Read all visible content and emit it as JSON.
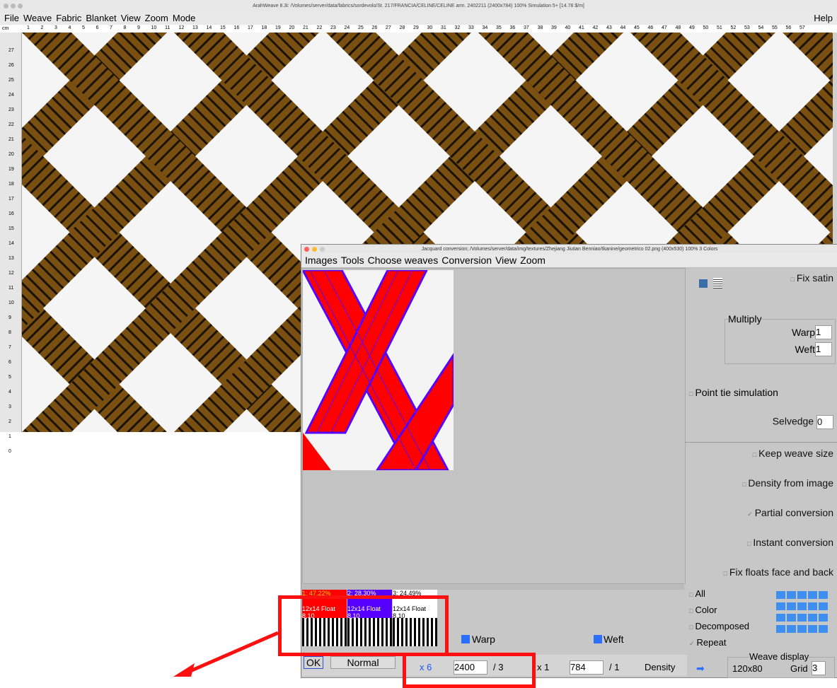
{
  "main_window": {
    "title": "ArahWeave 8.3i: /Volumes/server/data/fabrics/sordevolo/St. 217/FRANCIA/CELINE/CELINE arm. 2402211 (2400x784) 100% Simulation 5+ [14.78 $/m]",
    "menu": [
      "File",
      "Weave",
      "Fabric",
      "Blanket",
      "View",
      "Zoom",
      "Mode"
    ],
    "help": "Help",
    "ruler_unit": "cm",
    "ruler_top": [
      "1",
      "2",
      "3",
      "4",
      "5",
      "6",
      "7",
      "8",
      "9",
      "10",
      "11",
      "12",
      "13",
      "14",
      "15",
      "16",
      "17",
      "18",
      "19",
      "20",
      "21",
      "22",
      "23",
      "24",
      "25",
      "26",
      "27",
      "28",
      "29",
      "30",
      "31",
      "32",
      "33",
      "34",
      "35",
      "36",
      "37",
      "38",
      "39",
      "40",
      "41",
      "42",
      "43",
      "44",
      "45",
      "46",
      "47",
      "48",
      "49",
      "50",
      "51",
      "52",
      "53",
      "54",
      "55",
      "56",
      "57"
    ],
    "ruler_left": [
      "27",
      "26",
      "25",
      "24",
      "23",
      "22",
      "21",
      "20",
      "19",
      "18",
      "17",
      "16",
      "15",
      "14",
      "13",
      "12",
      "11",
      "10",
      "9",
      "8",
      "7",
      "6",
      "5",
      "4",
      "3",
      "2",
      "1",
      "0"
    ],
    "colors": {
      "brown": "#7a4f12",
      "dark": "#1a1200",
      "white": "#f5f5f5"
    }
  },
  "jacquard": {
    "title": "Jacquard conversion; /Volumes/server/data/img/textures/Zhejiang Jiutian Benniao/tkanine/geometrico 02.png (400x530) 100% 3 Colors",
    "menu": [
      "Images",
      "Tools",
      "Choose weaves",
      "Conversion",
      "View",
      "Zoom"
    ],
    "options": {
      "fix_satin": "Fix satin",
      "multiply": "Multiply",
      "warp": "Warp",
      "warp_value": "1",
      "weft": "Weft",
      "weft_value": "1",
      "point_tie": "Point tie simulation",
      "selvedge": "Selvedge",
      "selvedge_value": "0",
      "keep_weave_size": "Keep weave size",
      "density_from_image": "Density from image",
      "partial_conversion": "Partial conversion",
      "instant_conversion": "Instant conversion",
      "fix_floats": "Fix floats face and back"
    },
    "display_options": [
      "All",
      "Color",
      "Decomposed",
      "Repeat"
    ],
    "weave_display_label": "Weave display",
    "weave_display_value": "120x80",
    "grid_label": "Grid",
    "grid_value": "3",
    "colors": [
      {
        "pct": "1: 47.22%",
        "weave": "12x14 Float 8,10",
        "hex": "#ff0000"
      },
      {
        "pct": "2: 28.30%",
        "weave": "12x14 Float 8,10",
        "hex": "#5500ff"
      },
      {
        "pct": "3: 24.49%",
        "weave": "12x14 Float 8,10",
        "hex": "#ffffff"
      }
    ],
    "ok": "OK",
    "normal": "Normal",
    "warp_label": "Warp",
    "weft_label": "Weft",
    "warp_mult": "x 6",
    "warp_count": "2400",
    "warp_div": "/ 3",
    "weft_mult": "x 1",
    "weft_count": "784",
    "weft_div": "/ 1",
    "density": "Density"
  }
}
